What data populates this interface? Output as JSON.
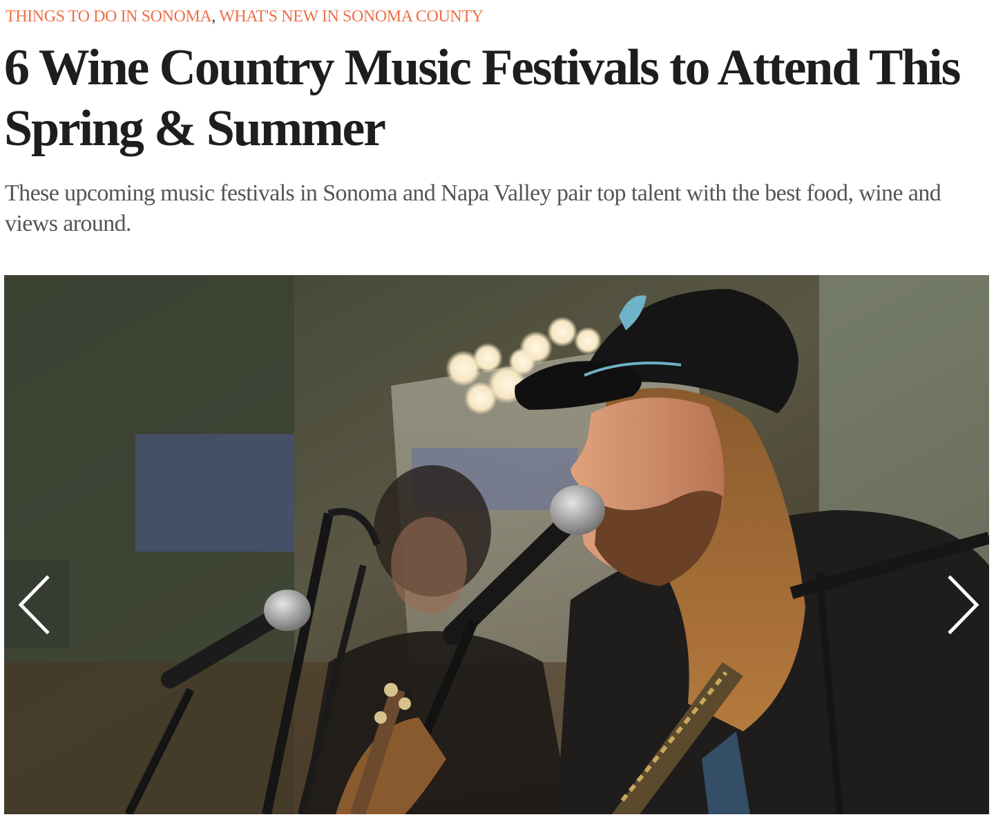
{
  "article": {
    "categories": [
      {
        "label": "THINGS TO DO IN SONOMA"
      },
      {
        "label": "WHAT'S NEW IN SONOMA COUNTY"
      }
    ],
    "category_separator": ",",
    "title": "6 Wine Country Music Festivals to Attend This Spring & Summer",
    "subtitle": "These upcoming music festivals in Sonoma and Napa Valley pair top talent with the best food, wine and views around."
  },
  "slider": {
    "prev_icon": "chevron-left-icon",
    "next_icon": "chevron-right-icon"
  },
  "colors": {
    "category_link": "#ee6f47",
    "title": "#1e1e1e",
    "subtitle": "#555555"
  }
}
